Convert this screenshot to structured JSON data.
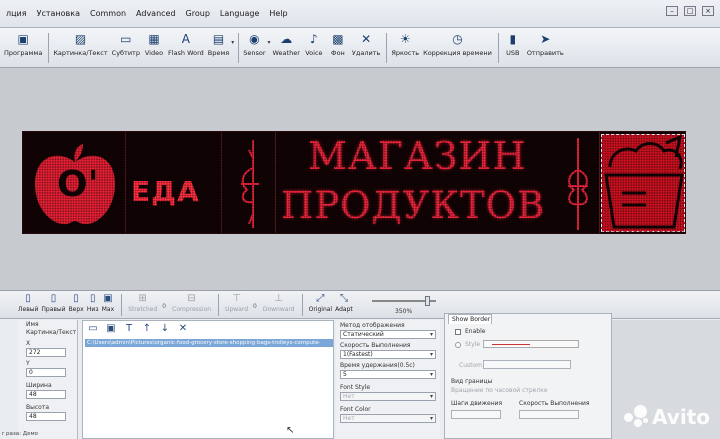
{
  "menu": {
    "items": [
      "лция",
      "Установка",
      "Common",
      "Advanced",
      "Group",
      "Language",
      "Help"
    ]
  },
  "toolbar": {
    "buttons": [
      {
        "label": "Программа",
        "icon": "program-icon",
        "glyph": "▣"
      },
      {
        "label": "Картинка/Текст",
        "icon": "image-text-icon",
        "glyph": "▨"
      },
      {
        "label": "Субтитр",
        "icon": "subtitle-icon",
        "glyph": "▭"
      },
      {
        "label": "Video",
        "icon": "video-icon",
        "glyph": "▦"
      },
      {
        "label": "Flash Word",
        "icon": "flash-word-icon",
        "glyph": "A"
      },
      {
        "label": "Время",
        "icon": "clock-icon",
        "glyph": "▤"
      },
      {
        "label": "Sensor",
        "icon": "sensor-icon",
        "glyph": "◉"
      },
      {
        "label": "Weather",
        "icon": "weather-icon",
        "glyph": "☁"
      },
      {
        "label": "Voice",
        "icon": "voice-icon",
        "glyph": "♪"
      },
      {
        "label": "Фон",
        "icon": "background-icon",
        "glyph": "▩"
      },
      {
        "label": "Удалить",
        "icon": "delete-icon",
        "glyph": "✕"
      },
      {
        "label": "Яркость",
        "icon": "brightness-icon",
        "glyph": "☀"
      },
      {
        "label": "Коррекция времени",
        "icon": "time-correction-icon",
        "glyph": "◷"
      },
      {
        "label": "USB",
        "icon": "usb-icon",
        "glyph": "▮"
      },
      {
        "label": "Отправить",
        "icon": "send-icon",
        "glyph": "➤"
      }
    ]
  },
  "led": {
    "logo": "O'",
    "eda": "ЕДА",
    "line1": "МАГАЗИН",
    "line2": "ПРОДУКТОВ"
  },
  "bottom_toolbar": {
    "align_buttons": [
      {
        "label": "Левый",
        "glyph": "▯"
      },
      {
        "label": "Правый",
        "glyph": "▯"
      },
      {
        "label": "Верх",
        "glyph": "▯"
      },
      {
        "label": "Низ",
        "glyph": "▯"
      },
      {
        "label": "Max",
        "glyph": "▣"
      }
    ],
    "stretch1": "Stretched",
    "stretch1_value": "0",
    "compression": "Compression",
    "upward": "Upward",
    "upward_value": "0",
    "downward": "Downward",
    "original": "Original",
    "adapt": "Adapt",
    "zoom_value": "350%"
  },
  "properties": {
    "name_label": "Имя",
    "name_value": "Картинка/Текст",
    "x_label": "X",
    "x_value": "272",
    "y_label": "Y",
    "y_value": "0",
    "width_label": "Ширина",
    "width_value": "48",
    "height_label": "Высота",
    "height_value": "48"
  },
  "file": {
    "path": "C:\\Users\\admin\\Pictures\\organic-food-grocery-store-shopping-bags-trolleys-compute-"
  },
  "effects": {
    "display_method_label": "Метод отображения",
    "display_method_value": "Статический",
    "speed_label": "Скорость Выполнения",
    "speed_value": "1(Fastest)",
    "hold_label": "Время удержания(0.5с)",
    "hold_value": "5",
    "font_style_label": "Font Style",
    "font_style_value": "Нет",
    "font_color_label": "Font Color",
    "font_color_value": "Нет"
  },
  "border": {
    "tab": "Show Border",
    "enable": "Enable",
    "style": "Style",
    "custom": "Custom",
    "border_view": "Вид границы",
    "rotate": "Вращение по часовой стрелке",
    "step": "Шаги движения",
    "speed": "Скорость Выполнения"
  },
  "status": {
    "text": "r раза: Демо"
  },
  "watermark": {
    "text": "Avito"
  },
  "colors": {
    "led_red": "#e8243a",
    "led_bg": "#120305",
    "selection": "#7aa6d8"
  }
}
